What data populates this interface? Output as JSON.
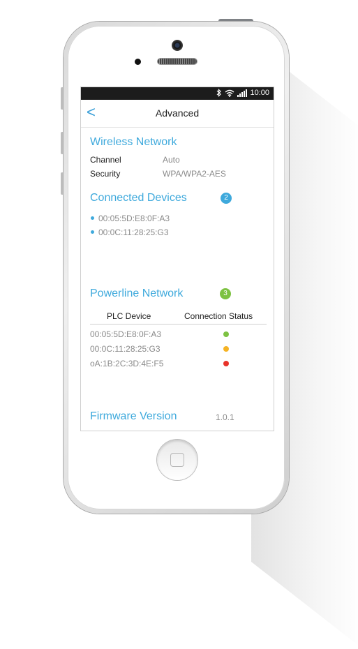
{
  "status_bar": {
    "time": "10:00"
  },
  "nav": {
    "back_glyph": "<",
    "title": "Advanced"
  },
  "wireless": {
    "title": "Wireless Network",
    "rows": [
      {
        "label": "Channel",
        "value": "Auto"
      },
      {
        "label": "Security",
        "value": "WPA/WPA2-AES"
      }
    ]
  },
  "connected": {
    "title": "Connected Devices",
    "count": "2",
    "badge_color": "#3ea9dc",
    "devices": [
      "00:05:5D:E8:0F:A3",
      "00:0C:11:28:25:G3"
    ]
  },
  "powerline": {
    "title": "Powerline Network",
    "count": "3",
    "badge_color": "#7dc242",
    "columns": [
      "PLC Device",
      "Connection Status"
    ],
    "rows": [
      {
        "device": "00:05:5D:E8:0F:A3",
        "status": "good",
        "color": "#7dc242"
      },
      {
        "device": "00:0C:11:28:25:G3",
        "status": "fair",
        "color": "#f5b324"
      },
      {
        "device": "oA:1B:2C:3D:4E:F5",
        "status": "poor",
        "color": "#e8332a"
      }
    ]
  },
  "firmware": {
    "title": "Firmware Version",
    "value": "1.0.1"
  },
  "icons": [
    "bluetooth-icon",
    "wifi-icon",
    "signal-icon",
    "back-chevron-icon",
    "camera-icon",
    "home-button-icon"
  ]
}
